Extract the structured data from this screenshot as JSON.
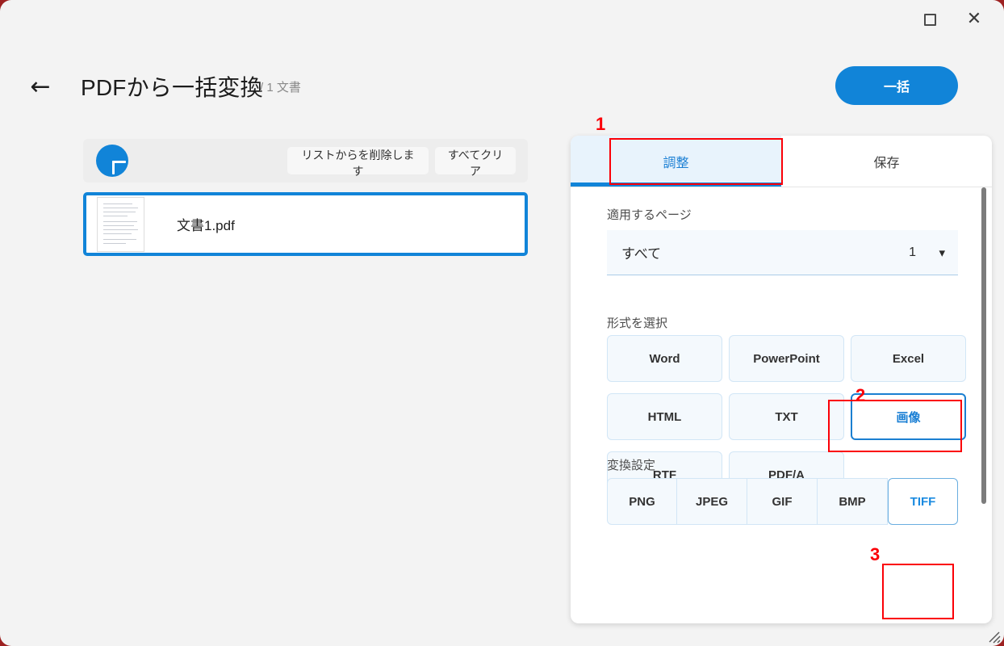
{
  "window": {
    "controls": {
      "maximize_icon": "maximize-icon",
      "close_icon": "close-icon"
    },
    "resize_grip_icon": "resize-grip-icon"
  },
  "header": {
    "back_icon": "back-arrow-icon",
    "title": "PDFから一括変換",
    "subtitle": "/ 1 文書",
    "batch_button_label": "一括"
  },
  "file_toolbar": {
    "add_icon": "plus-icon",
    "remove_from_list_label": "リストからを削除します",
    "clear_all_label": "すべてクリア"
  },
  "file_list": {
    "items": [
      {
        "name": "文書1.pdf",
        "thumbnail_icon": "pdf-page-thumbnail",
        "selected": true
      }
    ]
  },
  "right_panel": {
    "tabs": [
      {
        "label": "調整",
        "active": true
      },
      {
        "label": "保存",
        "active": false
      }
    ],
    "pages_section": {
      "label": "適用するページ",
      "select_value": "すべて",
      "select_count": "1",
      "chevron_icon": "chevron-down-icon"
    },
    "format_section": {
      "label": "形式を選択",
      "options": [
        {
          "label": "Word",
          "selected": false
        },
        {
          "label": "PowerPoint",
          "selected": false
        },
        {
          "label": "Excel",
          "selected": false
        },
        {
          "label": "HTML",
          "selected": false
        },
        {
          "label": "TXT",
          "selected": false
        },
        {
          "label": "画像",
          "selected": true
        },
        {
          "label": "RTF",
          "selected": false
        },
        {
          "label": "PDF/A",
          "selected": false
        }
      ]
    },
    "convert_settings_section": {
      "label": "変換設定",
      "options": [
        {
          "label": "PNG",
          "selected": false
        },
        {
          "label": "JPEG",
          "selected": false
        },
        {
          "label": "GIF",
          "selected": false
        },
        {
          "label": "BMP",
          "selected": false
        },
        {
          "label": "TIFF",
          "selected": true
        }
      ]
    },
    "scrollbar": {
      "visible": true
    }
  },
  "annotations": [
    {
      "number": "1",
      "target": "tab-adjust"
    },
    {
      "number": "2",
      "target": "format-option-image"
    },
    {
      "number": "3",
      "target": "convert-option-tiff"
    }
  ],
  "colors": {
    "accent_blue": "#1184d8",
    "tab_active_bg": "#e8f3fc",
    "annotation_red": "#fb0007",
    "window_bg": "#f3f3f3",
    "backdrop_red": "#9d2121"
  }
}
